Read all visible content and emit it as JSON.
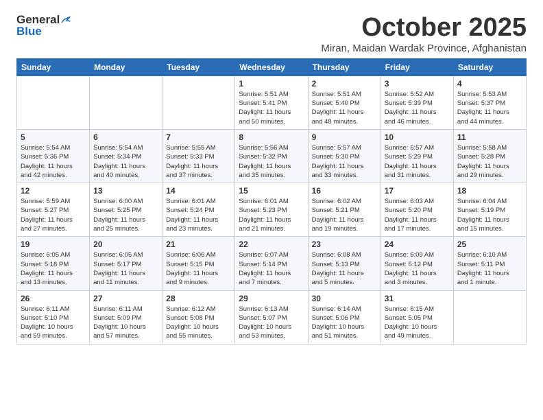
{
  "logo": {
    "general": "General",
    "blue": "Blue"
  },
  "header": {
    "month": "October 2025",
    "location": "Miran, Maidan Wardak Province, Afghanistan"
  },
  "weekdays": [
    "Sunday",
    "Monday",
    "Tuesday",
    "Wednesday",
    "Thursday",
    "Friday",
    "Saturday"
  ],
  "weeks": [
    [
      {
        "day": "",
        "content": ""
      },
      {
        "day": "",
        "content": ""
      },
      {
        "day": "",
        "content": ""
      },
      {
        "day": "1",
        "content": "Sunrise: 5:51 AM\nSunset: 5:41 PM\nDaylight: 11 hours\nand 50 minutes."
      },
      {
        "day": "2",
        "content": "Sunrise: 5:51 AM\nSunset: 5:40 PM\nDaylight: 11 hours\nand 48 minutes."
      },
      {
        "day": "3",
        "content": "Sunrise: 5:52 AM\nSunset: 5:39 PM\nDaylight: 11 hours\nand 46 minutes."
      },
      {
        "day": "4",
        "content": "Sunrise: 5:53 AM\nSunset: 5:37 PM\nDaylight: 11 hours\nand 44 minutes."
      }
    ],
    [
      {
        "day": "5",
        "content": "Sunrise: 5:54 AM\nSunset: 5:36 PM\nDaylight: 11 hours\nand 42 minutes."
      },
      {
        "day": "6",
        "content": "Sunrise: 5:54 AM\nSunset: 5:34 PM\nDaylight: 11 hours\nand 40 minutes."
      },
      {
        "day": "7",
        "content": "Sunrise: 5:55 AM\nSunset: 5:33 PM\nDaylight: 11 hours\nand 37 minutes."
      },
      {
        "day": "8",
        "content": "Sunrise: 5:56 AM\nSunset: 5:32 PM\nDaylight: 11 hours\nand 35 minutes."
      },
      {
        "day": "9",
        "content": "Sunrise: 5:57 AM\nSunset: 5:30 PM\nDaylight: 11 hours\nand 33 minutes."
      },
      {
        "day": "10",
        "content": "Sunrise: 5:57 AM\nSunset: 5:29 PM\nDaylight: 11 hours\nand 31 minutes."
      },
      {
        "day": "11",
        "content": "Sunrise: 5:58 AM\nSunset: 5:28 PM\nDaylight: 11 hours\nand 29 minutes."
      }
    ],
    [
      {
        "day": "12",
        "content": "Sunrise: 5:59 AM\nSunset: 5:27 PM\nDaylight: 11 hours\nand 27 minutes."
      },
      {
        "day": "13",
        "content": "Sunrise: 6:00 AM\nSunset: 5:25 PM\nDaylight: 11 hours\nand 25 minutes."
      },
      {
        "day": "14",
        "content": "Sunrise: 6:01 AM\nSunset: 5:24 PM\nDaylight: 11 hours\nand 23 minutes."
      },
      {
        "day": "15",
        "content": "Sunrise: 6:01 AM\nSunset: 5:23 PM\nDaylight: 11 hours\nand 21 minutes."
      },
      {
        "day": "16",
        "content": "Sunrise: 6:02 AM\nSunset: 5:21 PM\nDaylight: 11 hours\nand 19 minutes."
      },
      {
        "day": "17",
        "content": "Sunrise: 6:03 AM\nSunset: 5:20 PM\nDaylight: 11 hours\nand 17 minutes."
      },
      {
        "day": "18",
        "content": "Sunrise: 6:04 AM\nSunset: 5:19 PM\nDaylight: 11 hours\nand 15 minutes."
      }
    ],
    [
      {
        "day": "19",
        "content": "Sunrise: 6:05 AM\nSunset: 5:18 PM\nDaylight: 11 hours\nand 13 minutes."
      },
      {
        "day": "20",
        "content": "Sunrise: 6:05 AM\nSunset: 5:17 PM\nDaylight: 11 hours\nand 11 minutes."
      },
      {
        "day": "21",
        "content": "Sunrise: 6:06 AM\nSunset: 5:15 PM\nDaylight: 11 hours\nand 9 minutes."
      },
      {
        "day": "22",
        "content": "Sunrise: 6:07 AM\nSunset: 5:14 PM\nDaylight: 11 hours\nand 7 minutes."
      },
      {
        "day": "23",
        "content": "Sunrise: 6:08 AM\nSunset: 5:13 PM\nDaylight: 11 hours\nand 5 minutes."
      },
      {
        "day": "24",
        "content": "Sunrise: 6:09 AM\nSunset: 5:12 PM\nDaylight: 11 hours\nand 3 minutes."
      },
      {
        "day": "25",
        "content": "Sunrise: 6:10 AM\nSunset: 5:11 PM\nDaylight: 11 hours\nand 1 minute."
      }
    ],
    [
      {
        "day": "26",
        "content": "Sunrise: 6:11 AM\nSunset: 5:10 PM\nDaylight: 10 hours\nand 59 minutes."
      },
      {
        "day": "27",
        "content": "Sunrise: 6:11 AM\nSunset: 5:09 PM\nDaylight: 10 hours\nand 57 minutes."
      },
      {
        "day": "28",
        "content": "Sunrise: 6:12 AM\nSunset: 5:08 PM\nDaylight: 10 hours\nand 55 minutes."
      },
      {
        "day": "29",
        "content": "Sunrise: 6:13 AM\nSunset: 5:07 PM\nDaylight: 10 hours\nand 53 minutes."
      },
      {
        "day": "30",
        "content": "Sunrise: 6:14 AM\nSunset: 5:06 PM\nDaylight: 10 hours\nand 51 minutes."
      },
      {
        "day": "31",
        "content": "Sunrise: 6:15 AM\nSunset: 5:05 PM\nDaylight: 10 hours\nand 49 minutes."
      },
      {
        "day": "",
        "content": ""
      }
    ]
  ]
}
